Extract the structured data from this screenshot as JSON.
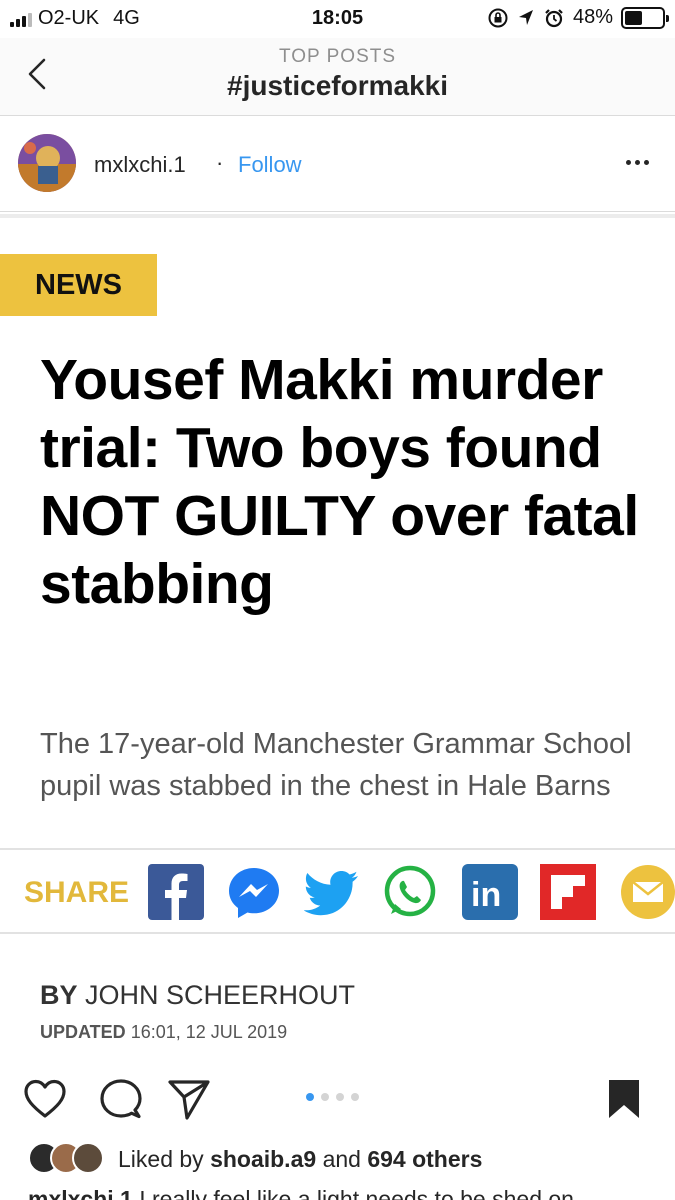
{
  "status_bar": {
    "carrier": "O2-UK",
    "network": "4G",
    "time": "18:05",
    "battery_percent": "48%",
    "battery_level": 0.48
  },
  "nav": {
    "subtitle": "TOP POSTS",
    "title": "#justiceformakki"
  },
  "post": {
    "username": "mxlxchi.1",
    "separator": "·",
    "follow_label": "Follow"
  },
  "article": {
    "tag": "NEWS",
    "headline": "Yousef Makki murder trial: Two boys found NOT GUILTY over fatal stabbing",
    "dek": "The 17-year-old Manchester Grammar School pupil was stabbed in the chest in Hale Barns",
    "share_label": "SHARE",
    "share_icons": [
      "facebook-icon",
      "messenger-icon",
      "twitter-icon",
      "whatsapp-icon",
      "linkedin-icon",
      "flipboard-icon",
      "email-icon"
    ],
    "by_label": "BY",
    "author": "JOHN SCHEERHOUT",
    "updated_label": "UPDATED",
    "updated_value": "16:01, 12 JUL 2019"
  },
  "carousel": {
    "total": 4,
    "active_index": 0
  },
  "likes": {
    "prefix": "Liked by",
    "user": "shoaib.a9",
    "joiner": "and",
    "others": "694 others"
  },
  "caption": {
    "username": "mxlxchi.1",
    "text": "I really feel like a light needs to be shed on"
  },
  "colors": {
    "accent_blue": "#3897f0",
    "news_yellow": "#edc23f",
    "share_yellow": "#e2b83b"
  }
}
